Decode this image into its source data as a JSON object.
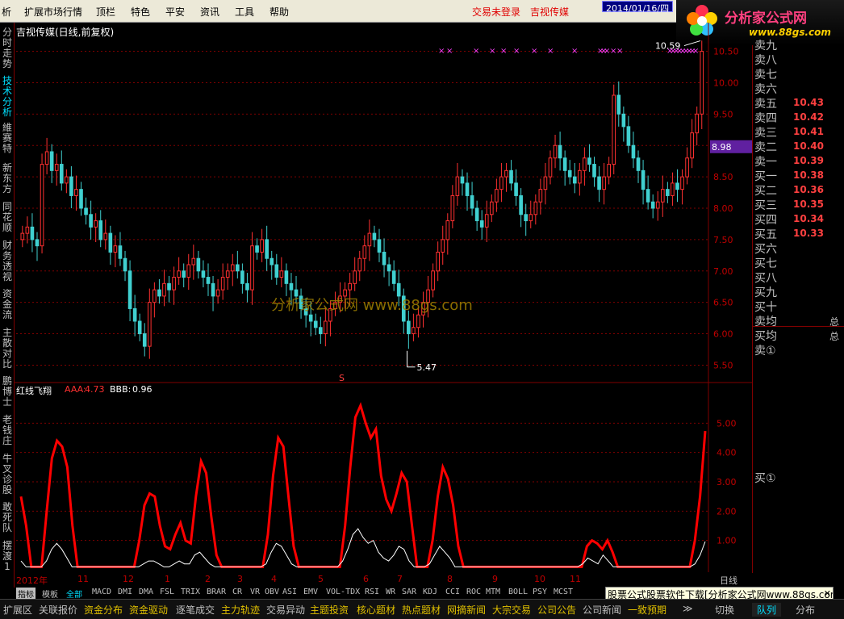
{
  "menu": [
    "析",
    "扩展市场行情",
    "顶栏",
    "特色",
    "平安",
    "资讯",
    "工具",
    "帮助"
  ],
  "status": {
    "login": "交易未登录",
    "stock": "吉视传媒"
  },
  "logo": {
    "name": "分析家公式网",
    "url": "www.88gs.com"
  },
  "left_tabs": [
    "分时走势",
    "技术分析",
    "維赛特",
    "新东方",
    "同花顺",
    "财务透视",
    "资金流",
    "主散对比",
    "鹏博士",
    "老钱庄",
    "牛叉诊股",
    "敢死队",
    "摆渡1"
  ],
  "main_title": "吉视传媒(日线,前复权)",
  "watermark": "分析家公式网 www.88gs.com",
  "price_axis": [
    "10.50",
    "10.00",
    "9.50",
    "9.00",
    "8.50",
    "8.00",
    "7.50",
    "7.00",
    "6.50",
    "6.00",
    "5.50"
  ],
  "current_price": "8.98",
  "annotations": {
    "high": "10.59",
    "low": "5.47",
    "marker": "S"
  },
  "indicator": {
    "name": "红线飞翔",
    "aaa_label": "AAA:",
    "aaa_value": "4.73",
    "bbb_label": "BBB:",
    "bbb_value": "0.96"
  },
  "ind_axis": [
    "5.00",
    "4.00",
    "3.00",
    "2.00",
    "1.00"
  ],
  "orderbook": {
    "sell": [
      {
        "label": "卖九",
        "price": ""
      },
      {
        "label": "卖八",
        "price": ""
      },
      {
        "label": "卖七",
        "price": ""
      },
      {
        "label": "卖六",
        "price": ""
      },
      {
        "label": "卖五",
        "price": "10.43"
      },
      {
        "label": "卖四",
        "price": "10.42"
      },
      {
        "label": "卖三",
        "price": "10.41"
      },
      {
        "label": "卖二",
        "price": "10.40"
      },
      {
        "label": "卖一",
        "price": "10.39"
      }
    ],
    "buy": [
      {
        "label": "买一",
        "price": "10.38"
      },
      {
        "label": "买二",
        "price": "10.36"
      },
      {
        "label": "买三",
        "price": "10.35"
      },
      {
        "label": "买四",
        "price": "10.34"
      },
      {
        "label": "买五",
        "price": "10.33"
      },
      {
        "label": "买六",
        "price": ""
      },
      {
        "label": "买七",
        "price": ""
      },
      {
        "label": "买八",
        "price": ""
      },
      {
        "label": "买九",
        "price": ""
      },
      {
        "label": "买十",
        "price": ""
      }
    ],
    "sell_avg": "卖均",
    "buy_avg": "买均",
    "sell_total": "卖①",
    "buy_total": "买①",
    "total_a": "总",
    "total_b": "总"
  },
  "date_axis": [
    {
      "label": "2012年"
    },
    {
      "label": "11"
    },
    {
      "label": "12"
    },
    {
      "label": "1"
    },
    {
      "label": "2"
    },
    {
      "label": "3"
    },
    {
      "label": "4"
    },
    {
      "label": "5"
    },
    {
      "label": "6"
    },
    {
      "label": "7"
    },
    {
      "label": "8"
    },
    {
      "label": "9"
    },
    {
      "label": "10"
    },
    {
      "label": "11"
    }
  ],
  "date_cursor": "2014/01/16/四",
  "period": "日线",
  "indicator_tabs": [
    "指标",
    "模板",
    "全部",
    "MACD",
    "DMI",
    "DMA",
    "FSL",
    "TRIX",
    "BRAR",
    "CR",
    "VR",
    "OBV",
    "ASI",
    "EMV",
    "VOL-TDX",
    "RSI",
    "WR",
    "SAR",
    "KDJ",
    "CCI",
    "ROC",
    "MTM",
    "BOLL",
    "PSY",
    "MCST"
  ],
  "bottom_items": [
    "扩展区",
    "关联报价",
    "资金分布",
    "资金驱动",
    "逐笔成交",
    "主力轨迹",
    "交易异动",
    "主题投资",
    "核心题材",
    "热点题材",
    "网摘新闻",
    "大宗交易",
    "公司公告",
    "公司新闻",
    "一致预期",
    "≫"
  ],
  "bottom_tabs": [
    "切换",
    "队列",
    "分布"
  ],
  "ticker": "股票公式股票软件下载[分析家公式网www.88gs.com]",
  "ticker_close": "✕",
  "colors": {
    "up": "#ff3030",
    "down": "#40d0d0",
    "line_red": "#ff0000",
    "line_white": "#ffffff",
    "grid": "#800000",
    "magenta": "#ff40ff"
  },
  "chart_data": {
    "type": "candlestick",
    "ylim": [
      5.3,
      10.7
    ],
    "high_label": 10.59,
    "low_label": 5.47,
    "current": 8.98,
    "close": [
      7.6,
      7.7,
      7.5,
      7.4,
      8.7,
      8.9,
      8.6,
      8.7,
      8.4,
      8.5,
      8.2,
      8.3,
      8.0,
      7.9,
      7.7,
      7.8,
      7.5,
      7.6,
      7.3,
      7.4,
      7.2,
      7.0,
      6.4,
      6.2,
      6.0,
      5.8,
      6.5,
      6.7,
      6.6,
      6.8,
      6.7,
      6.9,
      7.0,
      6.9,
      7.1,
      7.2,
      7.0,
      6.9,
      6.8,
      6.6,
      6.7,
      6.9,
      7.0,
      7.1,
      7.0,
      6.8,
      6.7,
      7.4,
      7.3,
      7.5,
      7.2,
      7.1,
      6.9,
      7.0,
      6.8,
      6.7,
      6.6,
      6.4,
      6.3,
      6.2,
      6.1,
      6.0,
      6.2,
      6.4,
      6.5,
      6.6,
      6.7,
      6.8,
      7.0,
      7.2,
      7.4,
      7.6,
      7.5,
      7.3,
      7.1,
      7.0,
      6.8,
      6.6,
      6.2,
      6.0,
      6.1,
      6.3,
      6.5,
      6.7,
      7.0,
      7.3,
      7.5,
      7.8,
      8.2,
      8.5,
      8.4,
      8.2,
      8.0,
      7.8,
      7.7,
      7.9,
      8.1,
      8.3,
      8.5,
      8.6,
      8.4,
      8.2,
      7.9,
      7.8,
      7.9,
      8.1,
      8.3,
      8.5,
      8.8,
      9.0,
      8.8,
      8.6,
      8.5,
      8.4,
      8.6,
      8.8,
      8.7,
      8.5,
      8.3,
      8.5,
      8.7,
      9.8,
      9.5,
      9.3,
      9.0,
      8.8,
      8.6,
      8.3,
      8.1,
      8.0,
      8.1,
      8.3,
      8.2,
      8.4,
      8.3,
      8.5,
      8.8,
      9.2,
      9.5,
      10.5
    ]
  },
  "indicator_data": {
    "red": [
      2.5,
      1.5,
      0.1,
      0.1,
      0.1,
      2.0,
      3.8,
      4.4,
      4.2,
      3.5,
      1.5,
      0.1,
      0.1,
      0.1,
      0.1,
      0.1,
      0.1,
      0.1,
      0.1,
      0.1,
      0.1,
      0.1,
      0.1,
      1.0,
      2.2,
      2.6,
      2.5,
      1.5,
      0.8,
      0.7,
      1.2,
      1.6,
      1.0,
      0.9,
      2.5,
      3.7,
      3.3,
      1.8,
      0.5,
      0.1,
      0.1,
      0.1,
      0.1,
      0.1,
      0.1,
      0.1,
      0.1,
      0.1,
      1.2,
      3.2,
      4.5,
      4.2,
      2.5,
      0.8,
      0.1,
      0.1,
      0.1,
      0.1,
      0.1,
      0.1,
      0.1,
      0.1,
      0.1,
      1.5,
      3.5,
      5.2,
      5.6,
      5.0,
      4.5,
      4.8,
      3.2,
      2.4,
      2.0,
      2.6,
      3.3,
      3.0,
      1.5,
      0.1,
      0.1,
      0.1,
      1.0,
      2.5,
      3.5,
      3.1,
      2.2,
      0.8,
      0.1,
      0.1,
      0.1,
      0.1,
      0.1,
      0.1,
      0.1,
      0.1,
      0.1,
      0.1,
      0.1,
      0.1,
      0.1,
      0.1,
      0.1,
      0.1,
      0.1,
      0.1,
      0.1,
      0.1,
      0.1,
      0.1,
      0.1,
      0.1,
      0.8,
      1.0,
      0.9,
      0.7,
      1.0,
      0.6,
      0.1,
      0.1,
      0.1,
      0.1,
      0.1,
      0.1,
      0.1,
      0.1,
      0.1,
      0.1,
      0.1,
      0.1,
      0.1,
      0.1,
      0.1,
      1.0,
      2.5,
      4.73
    ],
    "white": [
      0.3,
      0.1,
      0.1,
      0.1,
      0.1,
      0.3,
      0.7,
      0.9,
      0.7,
      0.4,
      0.1,
      0.1,
      0.1,
      0.1,
      0.1,
      0.1,
      0.1,
      0.1,
      0.1,
      0.1,
      0.1,
      0.1,
      0.1,
      0.1,
      0.2,
      0.3,
      0.3,
      0.2,
      0.1,
      0.1,
      0.2,
      0.3,
      0.2,
      0.2,
      0.5,
      0.6,
      0.4,
      0.2,
      0.1,
      0.1,
      0.1,
      0.1,
      0.1,
      0.1,
      0.1,
      0.1,
      0.1,
      0.1,
      0.2,
      0.6,
      0.9,
      0.8,
      0.5,
      0.2,
      0.1,
      0.1,
      0.1,
      0.1,
      0.1,
      0.1,
      0.1,
      0.1,
      0.1,
      0.3,
      0.7,
      1.2,
      1.4,
      1.1,
      0.9,
      1.0,
      0.6,
      0.4,
      0.3,
      0.5,
      0.8,
      0.7,
      0.3,
      0.1,
      0.1,
      0.1,
      0.2,
      0.5,
      0.8,
      0.6,
      0.4,
      0.1,
      0.1,
      0.1,
      0.1,
      0.1,
      0.1,
      0.1,
      0.1,
      0.1,
      0.1,
      0.1,
      0.1,
      0.1,
      0.1,
      0.1,
      0.1,
      0.1,
      0.1,
      0.1,
      0.1,
      0.1,
      0.1,
      0.1,
      0.1,
      0.1,
      0.2,
      0.4,
      0.3,
      0.2,
      0.5,
      0.3,
      0.1,
      0.1,
      0.1,
      0.1,
      0.1,
      0.1,
      0.1,
      0.1,
      0.1,
      0.1,
      0.1,
      0.1,
      0.1,
      0.1,
      0.1,
      0.1,
      0.2,
      0.5,
      0.96
    ],
    "ylim": [
      0,
      6
    ]
  }
}
